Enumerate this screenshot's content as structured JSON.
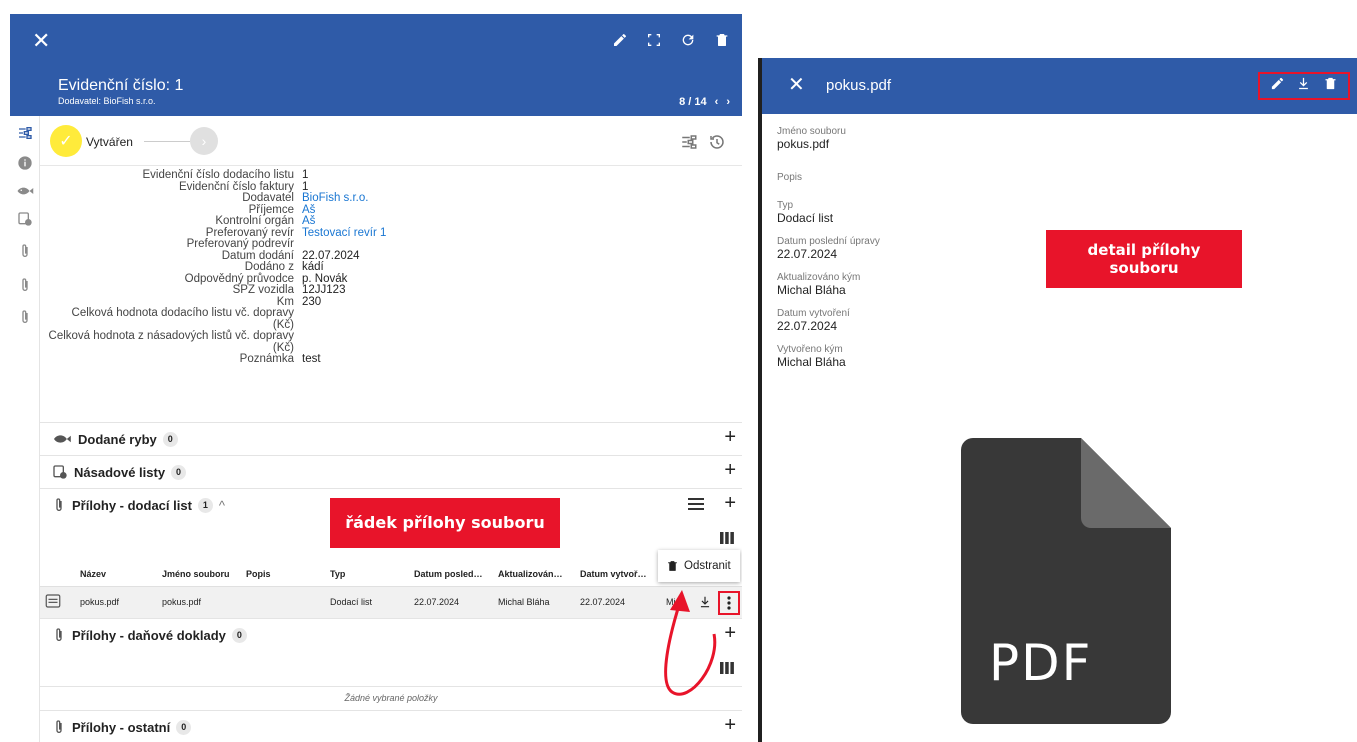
{
  "left": {
    "header": {
      "title": "Evidenční číslo: 1",
      "subtitle": "Dodavatel: BioFish s.r.o.",
      "pager": "8 / 14"
    },
    "status": {
      "label": "Vytvářen"
    },
    "details": [
      {
        "label": "Evidenční číslo dodacího listu",
        "value": "1",
        "link": false
      },
      {
        "label": "Evidenční číslo faktury",
        "value": "1",
        "link": false
      },
      {
        "label": "Dodavatel",
        "value": "BioFish s.r.o.",
        "link": true
      },
      {
        "label": "Příjemce",
        "value": "Aš",
        "link": true
      },
      {
        "label": "Kontrolní orgán",
        "value": "Aš",
        "link": true
      },
      {
        "label": "Preferovaný revír",
        "value": "Testovací revír 1",
        "link": true
      },
      {
        "label": "Preferovaný podrevír",
        "value": "",
        "link": false
      },
      {
        "label": "Datum dodání",
        "value": "22.07.2024",
        "link": false
      },
      {
        "label": "Dodáno z",
        "value": "kádí",
        "link": false
      },
      {
        "label": "Odpovědný průvodce",
        "value": "p. Novák",
        "link": false
      },
      {
        "label": "SPZ vozidla",
        "value": "12JJ123",
        "link": false
      },
      {
        "label": "Km",
        "value": "230",
        "link": false
      },
      {
        "label": "Celková hodnota dodacího listu vč. dopravy",
        "label2": "(Kč)",
        "value": "",
        "link": false
      },
      {
        "label": "Celková hodnota z násadových listů vč. dopravy",
        "label2": "(Kč)",
        "value": "",
        "link": false
      },
      {
        "label": "Poznámka",
        "value": "test",
        "link": false
      }
    ],
    "sections": {
      "fish": {
        "title": "Dodané ryby",
        "count": "0"
      },
      "stock": {
        "title": "Násadové listy",
        "count": "0"
      },
      "att_delivery": {
        "title": "Přílohy - dodací list",
        "count": "1"
      },
      "att_tax": {
        "title": "Přílohy - daňové doklady",
        "count": "0",
        "empty": "Žádné vybrané položky"
      },
      "att_other": {
        "title": "Přílohy - ostatní",
        "count": "0"
      }
    },
    "table": {
      "columns": [
        "Název",
        "Jméno souboru",
        "Popis",
        "Typ",
        "Datum posled…",
        "Aktualizován…",
        "Datum vytvoř…"
      ],
      "row": [
        "pokus.pdf",
        "pokus.pdf",
        "",
        "Dodací list",
        "22.07.2024",
        "Michal Bláha",
        "22.07.2024",
        "Mi"
      ]
    },
    "context_menu": {
      "delete": "Odstranit"
    },
    "callout": "řádek přílohy souboru"
  },
  "right": {
    "header": {
      "file_name": "pokus.pdf"
    },
    "fields": [
      {
        "label": "Jméno souboru",
        "value": "pokus.pdf"
      },
      {
        "label": "Popis",
        "value": ""
      },
      {
        "label": "Typ",
        "value": "Dodací list"
      },
      {
        "label": "Datum poslední úpravy",
        "value": "22.07.2024"
      },
      {
        "label": "Aktualizováno kým",
        "value": "Michal Bláha"
      },
      {
        "label": "Datum vytvoření",
        "value": "22.07.2024"
      },
      {
        "label": "Vytvořeno kým",
        "value": "Michal Bláha"
      }
    ],
    "callout_line1": "detail přílohy",
    "callout_line2": "souboru",
    "preview_label": "PDF"
  },
  "colors": {
    "header": "#2f5ba8",
    "accent_red": "#e8142a",
    "status_yellow": "#ffeb3b",
    "link": "#1976d2"
  },
  "icons": [
    "close-icon",
    "pencil-icon",
    "fullscreen-icon",
    "refresh-icon",
    "trash-icon",
    "download-icon",
    "more-vert-icon",
    "paperclip-icon",
    "fish-icon",
    "info-icon",
    "history-icon",
    "list-icon",
    "columns-icon",
    "pdf-file-icon"
  ]
}
